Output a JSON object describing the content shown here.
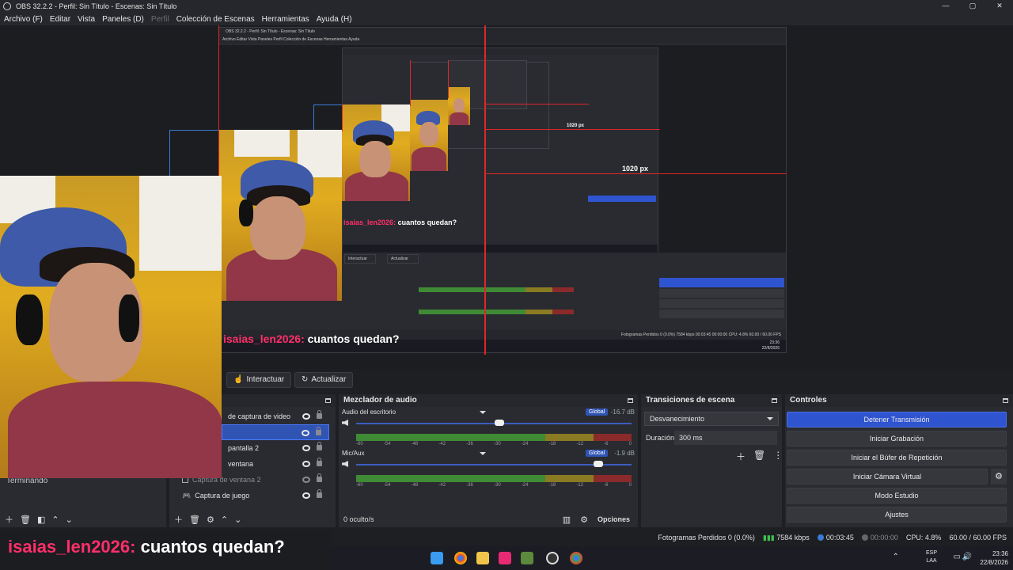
{
  "window": {
    "title": "OBS 32.2.2 - Perfil: Sin Título - Escenas: Sin Título",
    "minimize": "—",
    "maximize": "▢",
    "close": "✕"
  },
  "menu": [
    "Archivo (F)",
    "Editar",
    "Vista",
    "Paneles (D)",
    "Perfil",
    "Colección de Escenas",
    "Herramientas",
    "Ayuda (H)"
  ],
  "preview": {
    "nested_title": "OBS 32.2.2 - Perfil: Sin Título - Escenas: Sin Título",
    "nested_menu": "Archivo  Editar  Vista  Paneles  Perfil  Colección de Escenas  Herramientas  Ayuda",
    "px_label_1": "1020 px",
    "px_label_2": "1020 px",
    "chat_user_small": "isaias_len2026:",
    "chat_msg_small": "cuantos quedan?",
    "chat_user_mid": "isaias_len2026:",
    "chat_msg_mid": "cuantos quedan?",
    "nested_status": "Fotogramas Perdidos 0 (0.0%)   7584 kbps   00:03:45   00:00:00   CPU: 4.8%   60.00 / 60.00 FPS",
    "nested_clock": "23:36",
    "nested_date": "22/8/2026"
  },
  "toolbar": {
    "interact": "Interactuar",
    "refresh": "Actualizar"
  },
  "scenes": {
    "item": "Terminando"
  },
  "sources": {
    "items": [
      {
        "label": "de captura de video",
        "state": "normal"
      },
      {
        "label": "",
        "state": "selected"
      },
      {
        "label": "pantalla 2",
        "state": "normal"
      },
      {
        "label": "ventana",
        "state": "normal"
      },
      {
        "label": "Captura de ventana 2",
        "state": "dim"
      },
      {
        "label": "Captura de juego",
        "state": "normal"
      }
    ]
  },
  "mixer": {
    "title": "Mezclador de audio",
    "channels": [
      {
        "name": "Audio del escritorio",
        "global": "Global",
        "db": "-16.7 dB",
        "volume": 0.52
      },
      {
        "name": "Mic/Aux",
        "global": "Global",
        "db": "-1.9 dB",
        "volume": 0.88
      }
    ],
    "scale": [
      "-60",
      "-54",
      "-48",
      "-42",
      "-36",
      "-30",
      "-24",
      "-18",
      "-12",
      "-6",
      "0"
    ],
    "hidden": "0 oculto/s",
    "options": "Opciones"
  },
  "transitions": {
    "title": "Transiciones de escena",
    "selected": "Desvanecimiento",
    "duration_label": "Duración",
    "duration": "300 ms"
  },
  "controls": {
    "title": "Controles",
    "buttons": [
      "Detener Transmisión",
      "Iniciar Grabación",
      "Iniciar el Búfer de Repetición",
      "Iniciar Cámara Virtual",
      "Modo Estudio",
      "Ajustes"
    ]
  },
  "chat_overlay": {
    "user": "isaias_len2026:",
    "message": "cuantos quedan?"
  },
  "status": {
    "dropped": "Fotogramas Perdidos 0 (0.0%)",
    "bitrate": "7584 kbps",
    "stream_time": "00:03:45",
    "rec_time": "00:00:00",
    "cpu": "CPU: 4.8%",
    "fps": "60.00 / 60.00 FPS"
  },
  "taskbar": {
    "lang_1": "ESP",
    "lang_2": "LAA",
    "time": "23:36",
    "date": "22/8/2026"
  },
  "colors": {
    "accent": "#2f54d0",
    "chat_user": "#ff2f6a",
    "guide_red": "#e0262a"
  }
}
